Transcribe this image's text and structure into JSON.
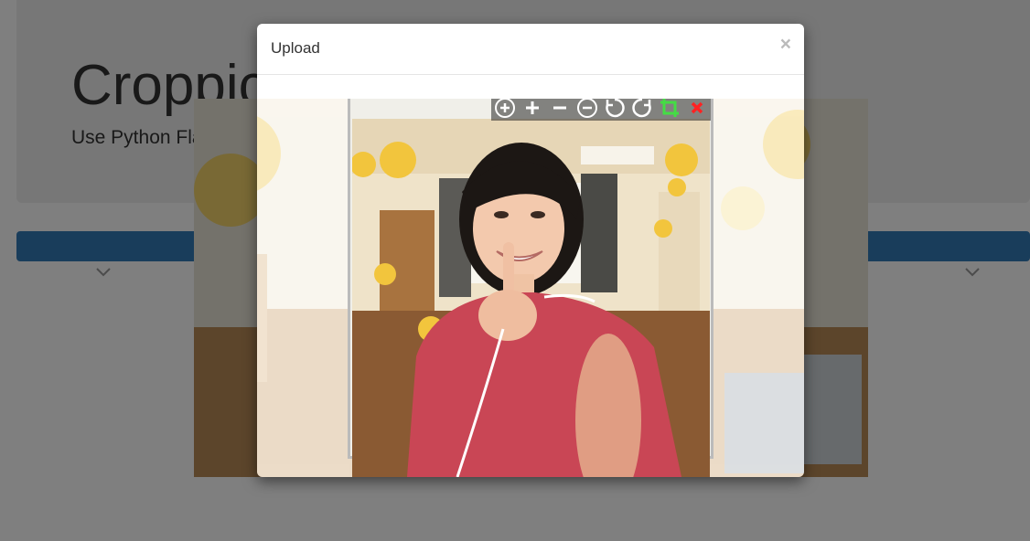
{
  "background_page": {
    "title": "Croppic",
    "subtitle": "Use Python Flask"
  },
  "modal": {
    "title": "Upload",
    "close_label": "×"
  },
  "toolbar": {
    "buttons": [
      {
        "icon": "zoom-in-circle-icon"
      },
      {
        "icon": "plus-icon"
      },
      {
        "icon": "minus-icon"
      },
      {
        "icon": "zoom-out-circle-icon"
      },
      {
        "icon": "rotate-left-icon"
      },
      {
        "icon": "rotate-right-icon"
      },
      {
        "icon": "crop-icon",
        "color": "#44dd44"
      },
      {
        "icon": "cancel-icon",
        "color": "#ff2222"
      }
    ]
  },
  "colors": {
    "primary_bar": "#337ab7",
    "crop_icon": "#44dd44",
    "cancel_icon": "#ff2222"
  }
}
